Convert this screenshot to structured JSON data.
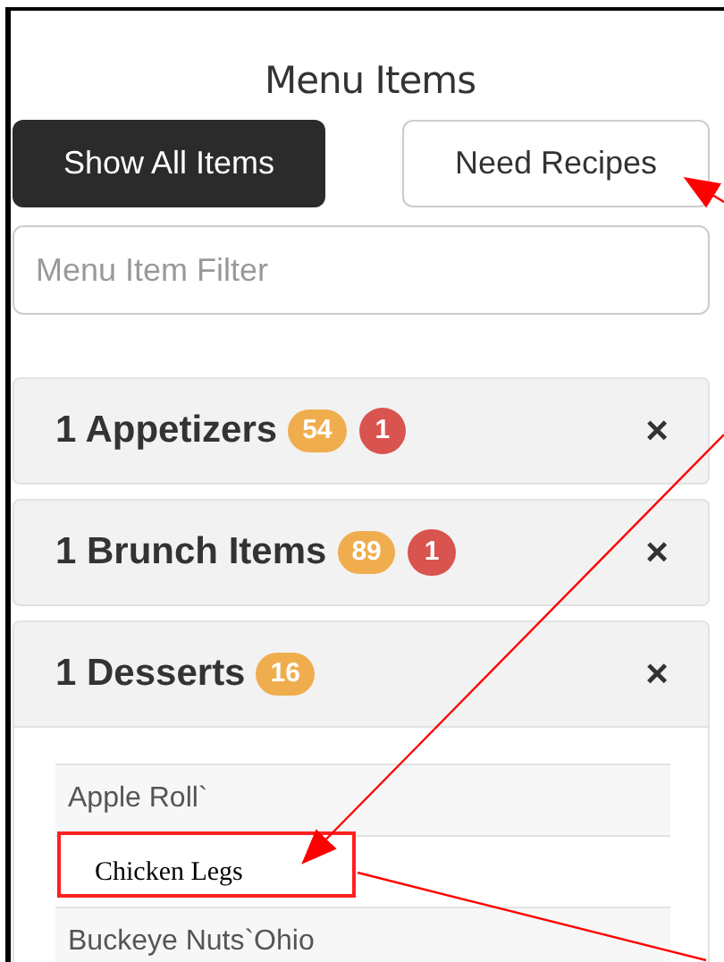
{
  "title": "Menu Items",
  "buttons": [
    {
      "label": "Show All Items",
      "selected": true
    },
    {
      "label": "Need Recipes",
      "selected": false
    }
  ],
  "filter": {
    "placeholder": "Menu Item Filter"
  },
  "categories": [
    {
      "name": "1 Appetizers",
      "count": "54",
      "flag": "1",
      "expanded": false,
      "close": "×"
    },
    {
      "name": "1 Brunch Items",
      "count": "89",
      "flag": "1",
      "expanded": false,
      "close": "×"
    },
    {
      "name": "1 Desserts",
      "count": "16",
      "expanded": true,
      "close": "×",
      "items": [
        {
          "kind": "item",
          "label": "Apple Roll`"
        },
        {
          "kind": "callout",
          "label": "Chicken Legs"
        },
        {
          "kind": "item",
          "label": "Buckeye Nuts`Ohio"
        }
      ]
    }
  ]
}
